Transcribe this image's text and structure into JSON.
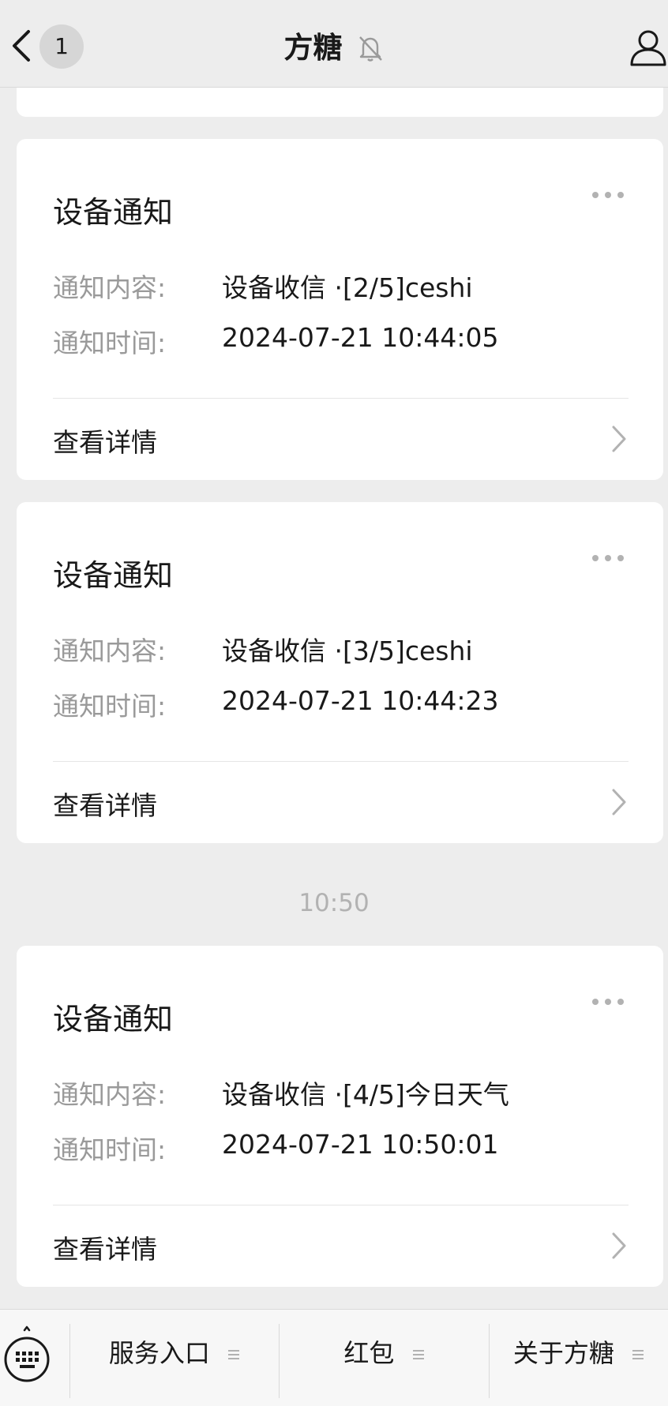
{
  "header": {
    "title": "方糖",
    "unread_count": "1",
    "icons": [
      "back-chevron-icon",
      "bell-muted-icon",
      "profile-icon"
    ]
  },
  "cards": [
    {
      "title": "设备通知",
      "content_label": "通知内容:",
      "content_value": "设备收信 ·[2/5]ceshi",
      "time_label": "通知时间:",
      "time_value": "2024-07-21 10:44:05",
      "detail_label": "查看详情"
    },
    {
      "title": "设备通知",
      "content_label": "通知内容:",
      "content_value": "设备收信 ·[3/5]ceshi",
      "time_label": "通知时间:",
      "time_value": "2024-07-21 10:44:23",
      "detail_label": "查看详情"
    },
    {
      "title": "设备通知",
      "content_label": "通知内容:",
      "content_value": "设备收信 ·[4/5]今日天气",
      "time_label": "通知时间:",
      "time_value": "2024-07-21 10:50:01",
      "detail_label": "查看详情"
    }
  ],
  "time_separator": "10:50",
  "bottom_menu": {
    "items": [
      {
        "label": "服务入口"
      },
      {
        "label": "红包"
      },
      {
        "label": "关于方糖"
      }
    ]
  },
  "colors": {
    "background": "#ededed",
    "card": "#ffffff",
    "label_gray": "#9a9a9a",
    "text": "#191919"
  }
}
